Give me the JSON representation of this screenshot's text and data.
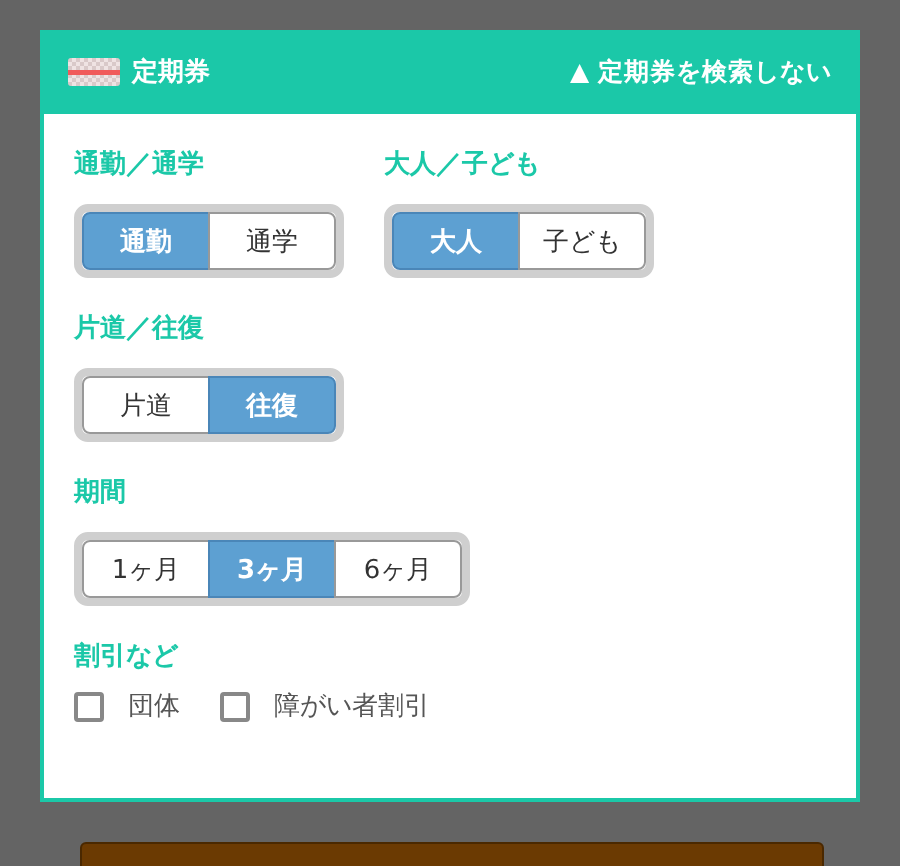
{
  "header": {
    "title": "定期券",
    "toggle": "▲ 定期券を検索しない"
  },
  "rows": [
    {
      "sections": [
        {
          "label": "通勤／通学",
          "kind": "segmented",
          "options": [
            {
              "label": "通勤",
              "selected": true
            },
            {
              "label": "通学",
              "selected": false
            }
          ]
        },
        {
          "label": "大人／子ども",
          "kind": "segmented",
          "options": [
            {
              "label": "大人",
              "selected": true
            },
            {
              "label": "子ども",
              "selected": false
            }
          ]
        }
      ]
    },
    {
      "sections": [
        {
          "label": "片道／往復",
          "kind": "segmented",
          "options": [
            {
              "label": "片道",
              "selected": false
            },
            {
              "label": "往復",
              "selected": true
            }
          ]
        }
      ]
    },
    {
      "sections": [
        {
          "label": "期間",
          "kind": "segmented",
          "options": [
            {
              "label": "1ヶ月",
              "selected": false
            },
            {
              "label": "3ヶ月",
              "selected": true
            },
            {
              "label": "6ヶ月",
              "selected": false
            }
          ]
        }
      ]
    },
    {
      "sections": [
        {
          "label": "割引など",
          "kind": "checkboxes",
          "options": [
            {
              "label": "団体",
              "checked": false
            },
            {
              "label": "障がい者割引",
              "checked": false
            }
          ]
        }
      ]
    }
  ]
}
